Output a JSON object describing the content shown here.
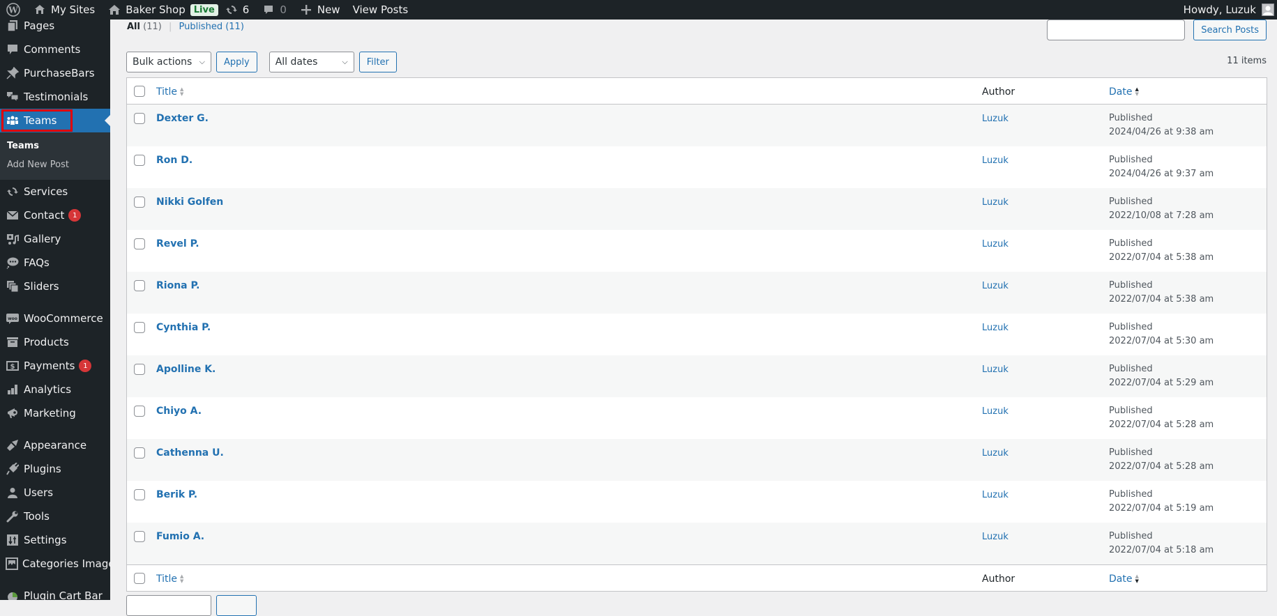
{
  "adminbar": {
    "my_sites": "My Sites",
    "site_name": "Baker Shop",
    "live_badge": "Live",
    "updates_count": "6",
    "comments_count": "0",
    "new_label": "New",
    "view_posts": "View Posts",
    "howdy": "Howdy, Luzuk"
  },
  "sidebar": {
    "items": [
      {
        "label": "Pages",
        "icon": "pages-icon"
      },
      {
        "label": "Comments",
        "icon": "comments-icon"
      },
      {
        "label": "PurchaseBars",
        "icon": "pin-icon"
      },
      {
        "label": "Testimonials",
        "icon": "testimonials-icon"
      },
      {
        "label": "Teams",
        "icon": "groups-icon",
        "active": true
      },
      {
        "label": "Services",
        "icon": "update-icon"
      },
      {
        "label": "Contact",
        "icon": "email-icon",
        "badge": "1"
      },
      {
        "label": "Gallery",
        "icon": "format-gallery-icon"
      },
      {
        "label": "FAQs",
        "icon": "chat-bubble-icon"
      },
      {
        "label": "Sliders",
        "icon": "images-icon"
      },
      {
        "label": "WooCommerce",
        "icon": "woo-icon"
      },
      {
        "label": "Products",
        "icon": "archive-icon"
      },
      {
        "label": "Payments",
        "icon": "money-icon",
        "badge": "1"
      },
      {
        "label": "Analytics",
        "icon": "chart-bar-icon"
      },
      {
        "label": "Marketing",
        "icon": "megaphone-icon"
      },
      {
        "label": "Appearance",
        "icon": "paintbrush-icon"
      },
      {
        "label": "Plugins",
        "icon": "plugin-icon"
      },
      {
        "label": "Users",
        "icon": "user-icon"
      },
      {
        "label": "Tools",
        "icon": "wrench-icon"
      },
      {
        "label": "Settings",
        "icon": "settings-icon"
      },
      {
        "label": "Categories Images",
        "icon": "image-icon"
      },
      {
        "label": "Plugin Cart Bar",
        "icon": "cart-bar-icon"
      }
    ],
    "submenu": [
      {
        "label": "Teams",
        "current": true
      },
      {
        "label": "Add New Post"
      }
    ]
  },
  "main": {
    "views": {
      "all_label": "All",
      "all_count": "(11)",
      "published_label": "Published",
      "published_count": "(11)"
    },
    "search": {
      "value": "",
      "button": "Search Posts"
    },
    "bulk_actions": "Bulk actions",
    "apply": "Apply",
    "dates": "All dates",
    "filter": "Filter",
    "items_count": "11 items",
    "columns": {
      "title": "Title",
      "author": "Author",
      "date": "Date"
    },
    "rows": [
      {
        "title": "Dexter G.",
        "author": "Luzuk",
        "status": "Published",
        "date": "2024/04/26 at 9:38 am"
      },
      {
        "title": "Ron D.",
        "author": "Luzuk",
        "status": "Published",
        "date": "2024/04/26 at 9:37 am"
      },
      {
        "title": "Nikki Golfen",
        "author": "Luzuk",
        "status": "Published",
        "date": "2022/10/08 at 7:28 am"
      },
      {
        "title": "Revel P.",
        "author": "Luzuk",
        "status": "Published",
        "date": "2022/07/04 at 5:38 am"
      },
      {
        "title": "Riona P.",
        "author": "Luzuk",
        "status": "Published",
        "date": "2022/07/04 at 5:38 am"
      },
      {
        "title": "Cynthia P.",
        "author": "Luzuk",
        "status": "Published",
        "date": "2022/07/04 at 5:30 am"
      },
      {
        "title": "Apolline K.",
        "author": "Luzuk",
        "status": "Published",
        "date": "2022/07/04 at 5:29 am"
      },
      {
        "title": "Chiyo A.",
        "author": "Luzuk",
        "status": "Published",
        "date": "2022/07/04 at 5:28 am"
      },
      {
        "title": "Cathenna U.",
        "author": "Luzuk",
        "status": "Published",
        "date": "2022/07/04 at 5:28 am"
      },
      {
        "title": "Berik P.",
        "author": "Luzuk",
        "status": "Published",
        "date": "2022/07/04 at 5:19 am"
      },
      {
        "title": "Fumio A.",
        "author": "Luzuk",
        "status": "Published",
        "date": "2022/07/04 at 5:18 am"
      }
    ]
  }
}
